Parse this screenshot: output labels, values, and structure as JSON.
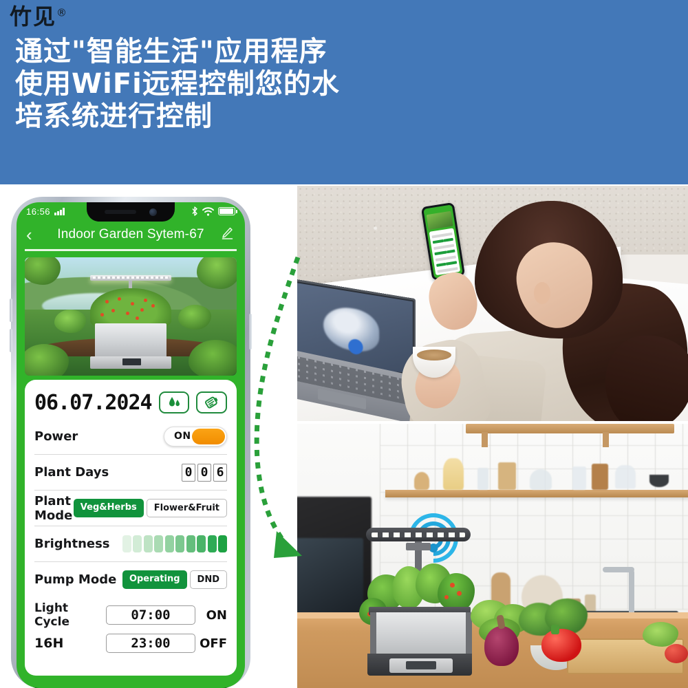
{
  "banner": {
    "brand": "竹见",
    "brand_mark": "®",
    "headline_lines": [
      "通过\"智能生活\"应用程序",
      "使用WiFi远程控制您的水",
      "培系统进行控制"
    ],
    "bg_color": "#4378b8",
    "text_color": "#ffffff"
  },
  "phone": {
    "status_bar": {
      "time": "16:56",
      "signal_icon": "cellular-signal-icon",
      "bluetooth_icon": "bluetooth-icon",
      "wifi_icon": "wifi-icon",
      "battery_icon": "battery-full-icon"
    },
    "app_bar": {
      "back_icon": "chevron-left-icon",
      "title": "Indoor Garden Sytem-67",
      "edit_icon": "pencil-edit-icon"
    },
    "hero_image_alt": "indoor-garden-unit-scenery",
    "card": {
      "date": "06.07.2024",
      "water_icon": "water-drops-icon",
      "fertilizer_icon": "nutrient-bottle-icon",
      "rows": {
        "power": {
          "label": "Power",
          "state": "ON",
          "accent": "#f59000"
        },
        "plant_days": {
          "label": "Plant Days",
          "digits": [
            "0",
            "0",
            "6"
          ]
        },
        "plant_mode": {
          "label": "Plant Mode",
          "options": [
            "Veg&Herbs",
            "Flower&Fruit"
          ],
          "selected": "Veg&Herbs",
          "accent": "#11933c"
        },
        "brightness": {
          "label": "Brightness",
          "levels": 10,
          "value": 10,
          "colors": [
            "#e2f2e4",
            "#d2ecd6",
            "#bee3c4",
            "#aadbb3",
            "#93d2a1",
            "#7cc88f",
            "#64be7c",
            "#4ab468",
            "#2eab55",
            "#1da243"
          ]
        },
        "pump_mode": {
          "label": "Pump Mode",
          "options": [
            "Operating",
            "DND"
          ],
          "selected": "Operating",
          "accent": "#11933c"
        },
        "light_cycle": {
          "label": "Light Cycle",
          "hours": "16H",
          "on_time": "07:00",
          "off_time": "23:00",
          "on_state": "ON",
          "off_state": "OFF"
        }
      }
    },
    "screen_accent": "#31b32a"
  },
  "arrow": {
    "name": "green-dashed-arrow",
    "color": "#2aa03a"
  },
  "photos": {
    "top": {
      "alt": "woman-using-phone-app-at-desk-with-laptop-and-coffee"
    },
    "bottom": {
      "alt": "hydroponic-indoor-garden-in-kitchen-with-wifi-signal"
    },
    "wifi_badge_color": "#23a8dd"
  }
}
